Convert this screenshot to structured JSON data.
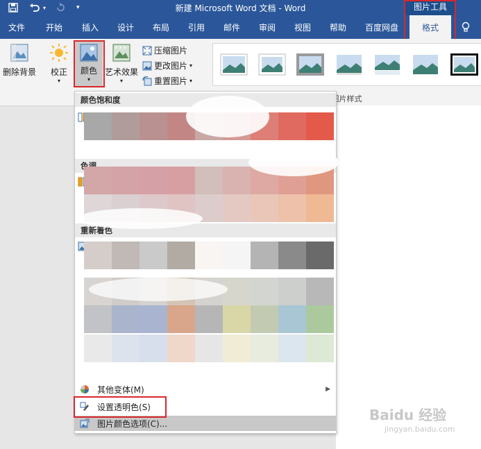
{
  "window": {
    "title": "新建 Microsoft Word 文档 - Word",
    "tools_label": "图片工具"
  },
  "tabs": [
    "文件",
    "开始",
    "插入",
    "设计",
    "布局",
    "引用",
    "邮件",
    "审阅",
    "视图",
    "帮助",
    "百度网盘",
    "格式"
  ],
  "ribbon": {
    "remove_bg": "删除背景",
    "corrections": "校正",
    "color": "颜色",
    "artistic": "艺术效果",
    "compress": "压缩图片",
    "change": "更改图片",
    "reset": "重置图片",
    "styles_group": "图片样式"
  },
  "dropdown": {
    "saturation_header": "颜色饱和度",
    "tone_header": "色调",
    "recolor_header": "重新着色",
    "more_variants": "其他变体(M)",
    "set_transparent": "设置透明色(S)",
    "picture_color_options": "图片颜色选项(C)..."
  },
  "swatches": {
    "saturation": [
      "#a8a8a8",
      "#b09c9b",
      "#b99190",
      "#c28785",
      "#c9a8a5",
      "#d49a96",
      "#dd7f76",
      "#e06a5f",
      "#e35a4b"
    ],
    "tone_row1": [
      "#d3a6a8",
      "#d4a3a7",
      "#d6a1a6",
      "#d79fa2",
      "#d2beba",
      "#d9b3af",
      "#dda9a2",
      "#df9f94",
      "#e0977f"
    ],
    "tone_row2": [
      "#dfd6d7",
      "#dacfd1",
      "#ddc9cb",
      "#e0c4c4",
      "#dccdcc",
      "#e4c9c2",
      "#e9c6b8",
      "#edc1aa",
      "#eeb993"
    ],
    "recolor_row1": [
      "#d5cdc9",
      "#c0b9b5",
      "#cacaca",
      "#b2aba3",
      "#f8f5f3",
      "#f5f5f5",
      "#b4b4b4",
      "#8a8a8a",
      "#6a6a6a"
    ],
    "recolor_row2": [
      "#d8d4d1",
      "#d0ccc9",
      "#d5d2cf",
      "#d3c4b5",
      "#d5d3d0",
      "#d6d6cc",
      "#d3d5d1",
      "#cccfcc",
      "#b8b8b8"
    ],
    "recolor_row3": [
      "#c2c3c6",
      "#aab4cd",
      "#a8b4d0",
      "#d9a68b",
      "#b6b6b6",
      "#d9d6a8",
      "#c3cab2",
      "#a9c6d5",
      "#acc99e"
    ],
    "recolor_row4": [
      "#e9e9e9",
      "#dde3ec",
      "#d7dfec",
      "#efd7c9",
      "#e6e6e6",
      "#f1ecd6",
      "#e8ecdf",
      "#dce6ee",
      "#dde8d5"
    ]
  }
}
